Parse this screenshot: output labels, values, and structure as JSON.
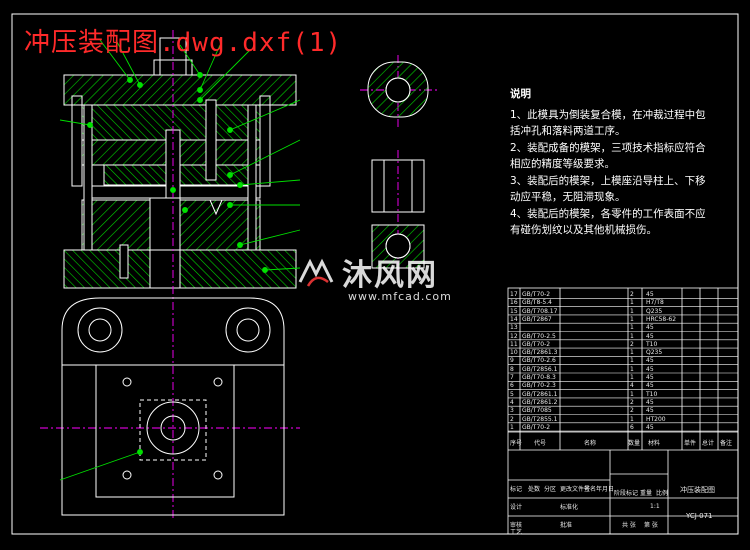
{
  "title": "冲压装配图.dwg.dxf(1)",
  "notes": {
    "heading": "说明",
    "lines": [
      "1、此模具为倒装复合模，在冲裁过程中包括冲孔和落料两道工序。",
      "2、装配成备的模架，三项技术指标应符合相应的精度等级要求。",
      "3、装配后的模架，上模座沿导柱上、下移动应平稳，无阻滞现象。",
      "4、装配后的模架，各零件的工作表面不应有碰伤划纹以及其他机械损伤。"
    ]
  },
  "watermark": {
    "brand": "沐风网",
    "url": "www.mfcad.com"
  },
  "titleblock": {
    "drawing_name": "冲压装配图",
    "drawing_no": "YCJ-071",
    "scale": "1:1",
    "header_cells": [
      "序号",
      "代号",
      "名称",
      "数量",
      "材料",
      "单件",
      "总计",
      "备注"
    ],
    "rows": [
      [
        "17",
        "GB/T70-2",
        "",
        "2",
        "45",
        ""
      ],
      [
        "16",
        "GB/T8-5.4",
        "",
        "1",
        "H7/T8",
        ""
      ],
      [
        "15",
        "GB/T708.17",
        "",
        "1",
        "Q235",
        ""
      ],
      [
        "14",
        "GB/T2867",
        "",
        "1",
        "HRC58-62",
        ""
      ],
      [
        "13",
        "",
        "",
        "1",
        "45",
        ""
      ],
      [
        "12",
        "GB/T70-2.5",
        "",
        "1",
        "45",
        ""
      ],
      [
        "11",
        "GB/T70-2",
        "",
        "2",
        "T10",
        ""
      ],
      [
        "10",
        "GB/T2861.3",
        "",
        "1",
        "Q235",
        ""
      ],
      [
        "9",
        "GB/T70-2.6",
        "",
        "1",
        "45",
        ""
      ],
      [
        "8",
        "GB/T2856.1",
        "",
        "1",
        "45",
        ""
      ],
      [
        "7",
        "GB/T70-8.3",
        "",
        "1",
        "45",
        ""
      ],
      [
        "6",
        "GB/T70-2.3",
        "",
        "4",
        "45",
        ""
      ],
      [
        "5",
        "GB/T2861.1",
        "",
        "1",
        "T10",
        ""
      ],
      [
        "4",
        "GB/T2861.2",
        "",
        "2",
        "45",
        ""
      ],
      [
        "3",
        "GB/T7085",
        "",
        "2",
        "45",
        ""
      ],
      [
        "2",
        "GB/T2855.1",
        "",
        "1",
        "HT200",
        ""
      ],
      [
        "1",
        "GB/T70-2",
        "",
        "6",
        "45",
        ""
      ]
    ],
    "bottom_labels": [
      "标记",
      "处数",
      "分区",
      "更改文件号",
      "签名",
      "年月日",
      "设计",
      "标准化",
      "阶段标记",
      "重量",
      "比例",
      "审核",
      "工艺",
      "批准",
      "共 张",
      "第 张"
    ]
  },
  "colors": {
    "background": "#000000",
    "outline": "#ffffff",
    "hatch": "#00d400",
    "leader": "#00e000",
    "centerline": "#ff00ff",
    "title": "#ff2a2a"
  }
}
